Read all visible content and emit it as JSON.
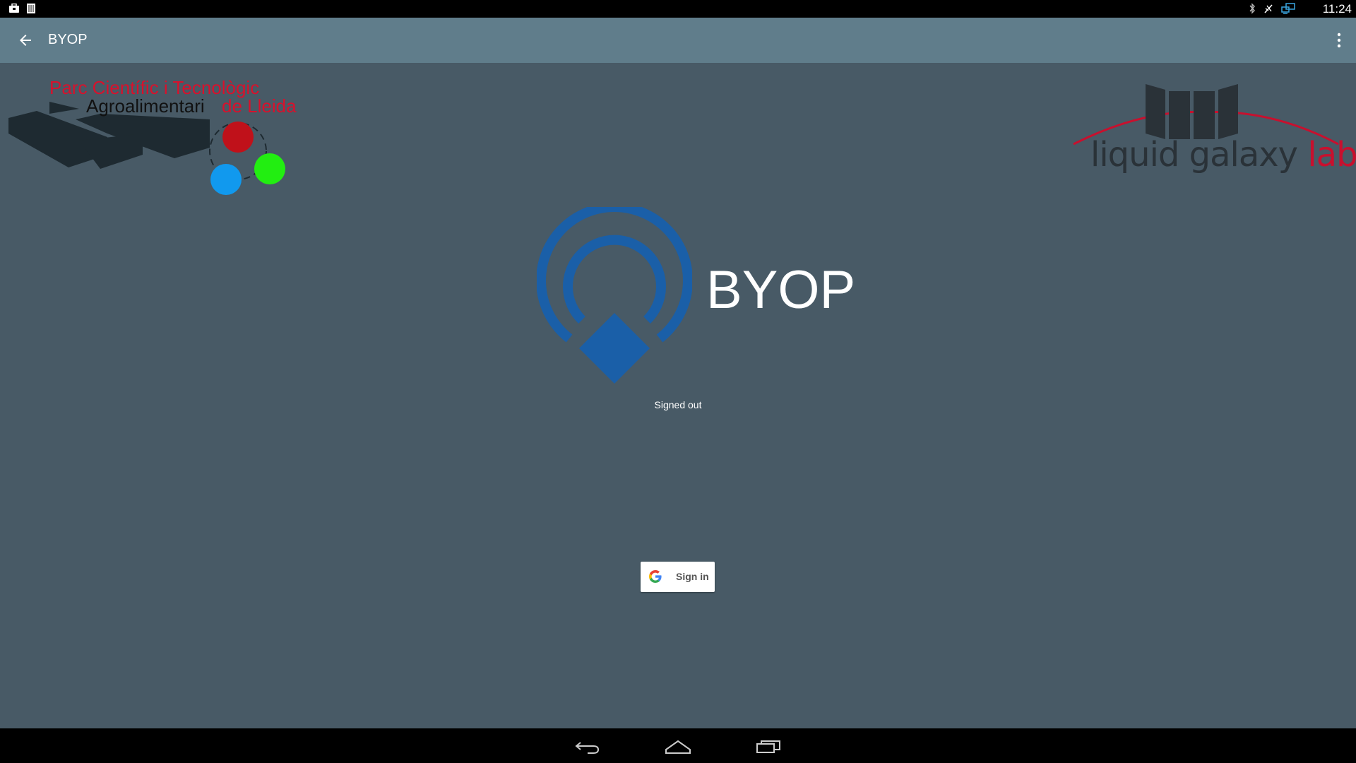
{
  "status_bar": {
    "time": "11:24",
    "left_icons": [
      "briefcase-icon",
      "sim-card-icon"
    ],
    "right_icons": [
      "bluetooth-icon",
      "no-signal-icon",
      "screen-cast-icon"
    ]
  },
  "app_bar": {
    "title": "BYOP",
    "back_icon": "arrow-back-icon",
    "menu_icon": "more-vert-icon",
    "color": "#607d8b"
  },
  "logos": {
    "pct_line1": "Parc Científic i Tecnològic",
    "pct_line2a": "Agroalimentari",
    "pct_line2b": "de Lleida",
    "lg_word": "liquid galaxy",
    "lg_lab": "lab"
  },
  "main": {
    "app_name": "BYOP",
    "status": "Signed out",
    "background": "#485a66",
    "accent": "#1a5fa8"
  },
  "signin": {
    "label": "Sign in"
  },
  "nav_bar": {
    "icons": [
      "back-nav-icon",
      "home-nav-icon",
      "recents-nav-icon"
    ]
  }
}
